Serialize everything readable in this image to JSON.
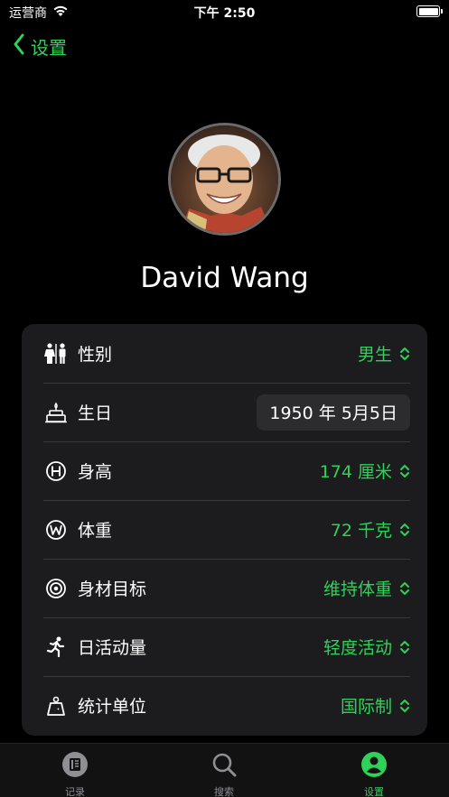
{
  "status_bar": {
    "carrier": "运营商",
    "time": "下午 2:50"
  },
  "nav": {
    "back_label": "设置"
  },
  "profile": {
    "name": "David Wang"
  },
  "rows": [
    {
      "icon": "gender-icon",
      "label": "性别",
      "value": "男生"
    },
    {
      "icon": "birthday-cake-icon",
      "label": "生日",
      "value": "1950 年 5月5日"
    },
    {
      "icon": "height-h-icon",
      "label": "身高",
      "value": "174 厘米"
    },
    {
      "icon": "weight-w-icon",
      "label": "体重",
      "value": "72 千克"
    },
    {
      "icon": "target-icon",
      "label": "身材目标",
      "value": "维持体重"
    },
    {
      "icon": "running-person-icon",
      "label": "日活动量",
      "value": "轻度活动"
    },
    {
      "icon": "scale-weight-icon",
      "label": "统计单位",
      "value": "国际制"
    }
  ],
  "tabs": [
    {
      "icon": "journal-icon",
      "label": "记录",
      "active": false
    },
    {
      "icon": "search-icon",
      "label": "搜索",
      "active": false
    },
    {
      "icon": "person-circle-icon",
      "label": "设置",
      "active": true
    }
  ],
  "colors": {
    "accent": "#30d158",
    "background": "#000000",
    "card": "#1c1c1e",
    "inactive": "#8e8e93"
  }
}
